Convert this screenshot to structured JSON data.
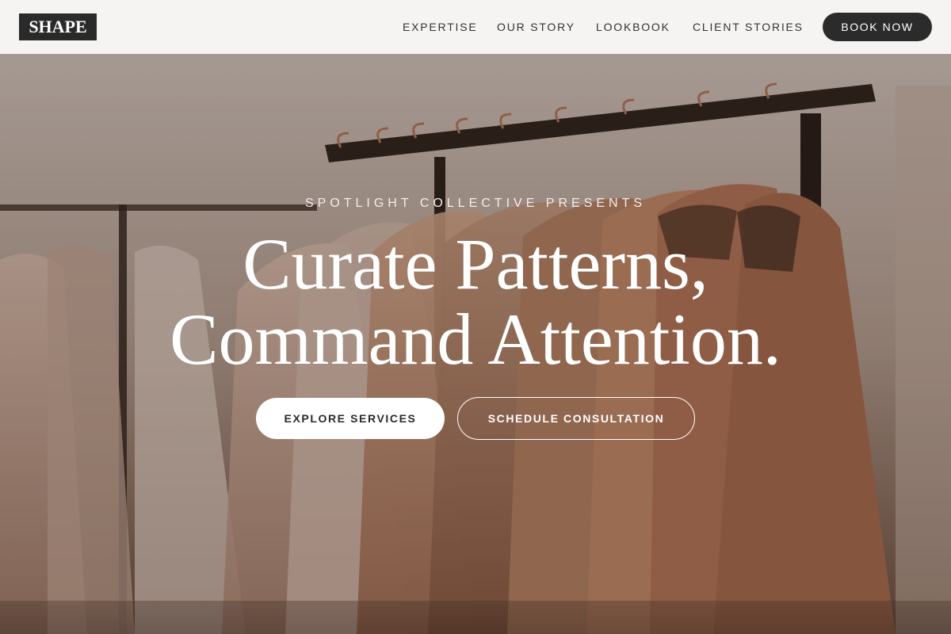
{
  "brand": {
    "logo_text": "SHAPE"
  },
  "nav": {
    "items": [
      {
        "label": "EXPERTISE"
      },
      {
        "label": "OUR STORY"
      },
      {
        "label": "LOOKBOOK"
      },
      {
        "label": "CLIENT STORIES"
      }
    ],
    "cta_label": "BOOK NOW"
  },
  "hero": {
    "eyebrow": "SPOTLIGHT COLLECTIVE PRESENTS",
    "headline_line1": "Curate Patterns,",
    "headline_line2": "Command Attention.",
    "primary_button": "EXPLORE SERVICES",
    "secondary_button": "SCHEDULE CONSULTATION",
    "background_image": "clothing-rack-with-dresses"
  },
  "colors": {
    "header_bg": "#f5f4f2",
    "logo_bg": "#2a2a2a",
    "cta_bg": "#2b2b2b",
    "text_dark": "#333333",
    "hero_text": "#ffffff"
  }
}
